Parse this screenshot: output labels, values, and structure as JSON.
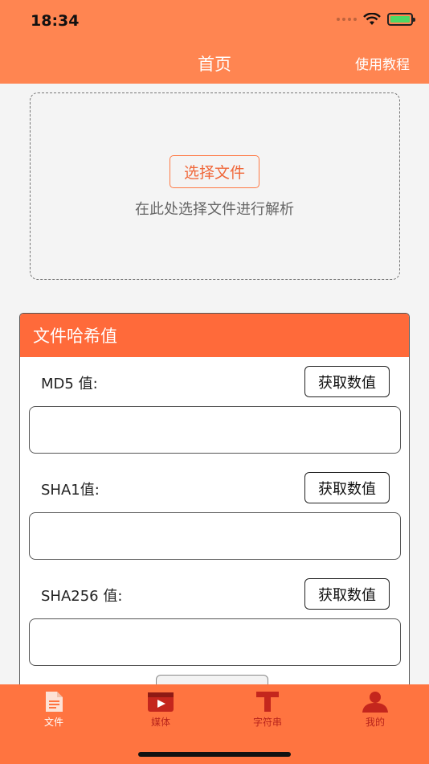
{
  "status": {
    "time": "18:34"
  },
  "nav": {
    "title": "首页",
    "right": "使用教程"
  },
  "picker": {
    "button": "选择文件",
    "hint": "在此处选择文件进行解析"
  },
  "hash_panel": {
    "title": "文件哈希值",
    "rows": [
      {
        "label": "MD5 值:",
        "button": "获取数值",
        "value": ""
      },
      {
        "label": "SHA1值:",
        "button": "获取数值",
        "value": ""
      },
      {
        "label": "SHA256 值:",
        "button": "获取数值",
        "value": ""
      }
    ]
  },
  "tabs": [
    {
      "label": "文件",
      "icon": "file-icon"
    },
    {
      "label": "媒体",
      "icon": "media-icon"
    },
    {
      "label": "字符串",
      "icon": "text-icon"
    },
    {
      "label": "我的",
      "icon": "user-icon"
    }
  ],
  "colors": {
    "accent": "#ff8551",
    "panel_head": "#ff6a3a",
    "tab_inactive": "#b8231b"
  }
}
